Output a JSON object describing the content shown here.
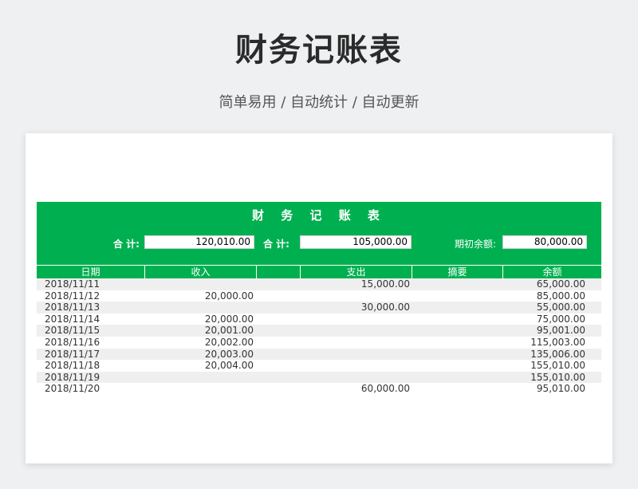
{
  "page": {
    "title": "财务记账表",
    "subtitle": "简单易用 / 自动统计 / 自动更新"
  },
  "sheet": {
    "title": "财 务 记 账 表",
    "income_label": "合 计:",
    "income_total": "120,010.00",
    "expense_label": "合 计:",
    "expense_total": "105,000.00",
    "opening_label": "期初余额:",
    "opening_balance": "80,000.00",
    "columns": [
      "日期",
      "收入",
      "",
      "支出",
      "摘要",
      "余额"
    ],
    "rows": [
      {
        "date": "2018/11/11",
        "income": "",
        "expense": "15,000.00",
        "summary": "",
        "balance": "65,000.00"
      },
      {
        "date": "2018/11/12",
        "income": "20,000.00",
        "expense": "",
        "summary": "",
        "balance": "85,000.00"
      },
      {
        "date": "2018/11/13",
        "income": "",
        "expense": "30,000.00",
        "summary": "",
        "balance": "55,000.00"
      },
      {
        "date": "2018/11/14",
        "income": "20,000.00",
        "expense": "",
        "summary": "",
        "balance": "75,000.00"
      },
      {
        "date": "2018/11/15",
        "income": "20,001.00",
        "expense": "",
        "summary": "",
        "balance": "95,001.00"
      },
      {
        "date": "2018/11/16",
        "income": "20,002.00",
        "expense": "",
        "summary": "",
        "balance": "115,003.00"
      },
      {
        "date": "2018/11/17",
        "income": "20,003.00",
        "expense": "",
        "summary": "",
        "balance": "135,006.00"
      },
      {
        "date": "2018/11/18",
        "income": "20,004.00",
        "expense": "",
        "summary": "",
        "balance": "155,010.00"
      },
      {
        "date": "2018/11/19",
        "income": "",
        "expense": "",
        "summary": "",
        "balance": "155,010.00"
      },
      {
        "date": "2018/11/20",
        "income": "",
        "expense": "60,000.00",
        "summary": "",
        "balance": "95,010.00"
      }
    ]
  },
  "colors": {
    "accent": "#00b050",
    "row_alt": "#efefef"
  }
}
